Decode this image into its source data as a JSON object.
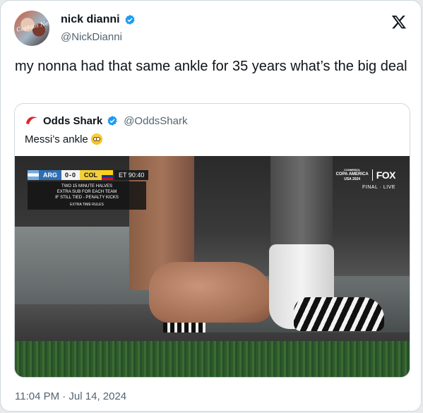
{
  "author": {
    "display_name": "nick dianni",
    "handle": "@NickDianni",
    "avatar_text": "Captain Ne"
  },
  "tweet": {
    "text": "my nonna had that same ankle for 35 years what’s the big deal",
    "timestamp": "11:04 PM · Jul 14, 2024"
  },
  "quoted": {
    "display_name": "Odds Shark",
    "handle": "@OddsShark",
    "text": "Messi’s ankle",
    "emoji": "flushed-face"
  },
  "broadcast": {
    "team1": "ARG",
    "score": "0-0",
    "team2": "COL",
    "clock": "ET  90:40",
    "info_lines": [
      "TWO 15 MINUTE HALVES",
      "EXTRA SUB FOR EACH TEAM",
      "IF STILL TIED - PENALTY KICKS"
    ],
    "info_small": "EXTRA TIME RULES",
    "tournament_line1": "CONMEBOL",
    "tournament_line2": "COPA AMERICA",
    "tournament_line3": "USA 2024",
    "network": "FOX",
    "status": "FINAL · LIVE"
  },
  "colors": {
    "verified": "#1d9bf0",
    "secondary_text": "#536471",
    "border": "#cfd9de"
  }
}
